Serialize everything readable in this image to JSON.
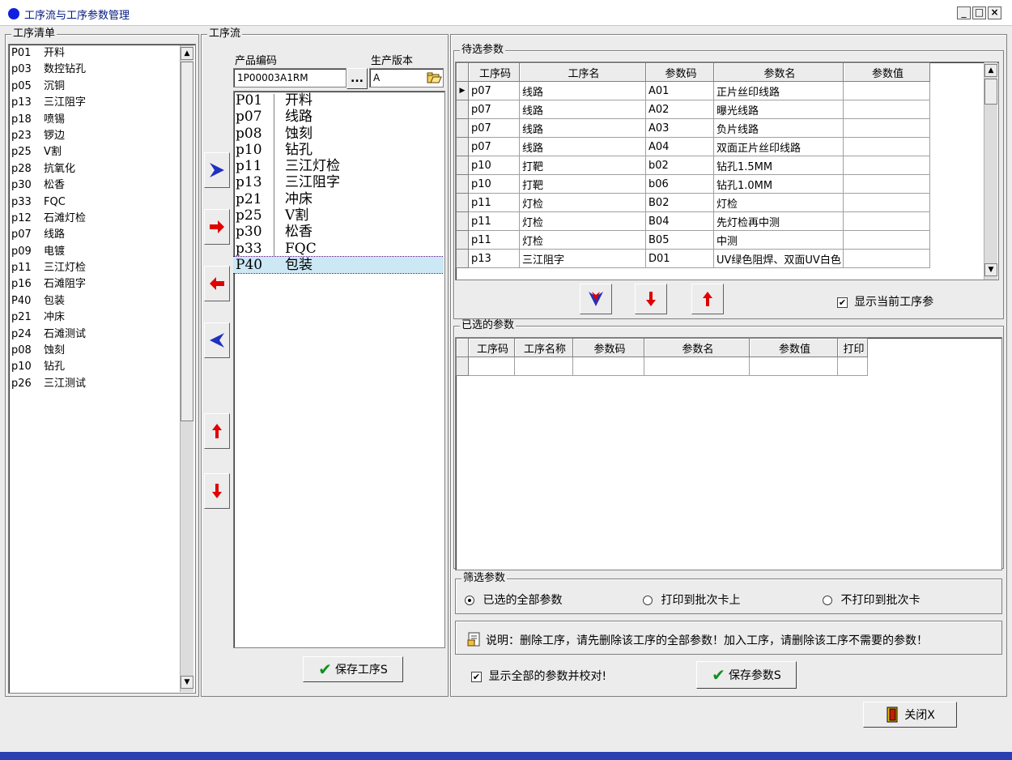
{
  "window": {
    "title": "工序流与工序参数管理",
    "minimize": "_",
    "maximize": "□",
    "close": "×"
  },
  "process_list": {
    "label": "工序清单",
    "items": [
      {
        "code": "P01",
        "name": "开料"
      },
      {
        "code": "p03",
        "name": "数控钻孔"
      },
      {
        "code": "p05",
        "name": "沉铜"
      },
      {
        "code": "p13",
        "name": "三江阻字"
      },
      {
        "code": "p18",
        "name": "喷锡"
      },
      {
        "code": "p23",
        "name": "锣边"
      },
      {
        "code": "p25",
        "name": "V割"
      },
      {
        "code": "p28",
        "name": "抗氧化"
      },
      {
        "code": "p30",
        "name": "松香"
      },
      {
        "code": "p33",
        "name": "FQC"
      },
      {
        "code": "p12",
        "name": "石滩灯检"
      },
      {
        "code": "p07",
        "name": "线路"
      },
      {
        "code": "p09",
        "name": "电镀"
      },
      {
        "code": "p11",
        "name": "三江灯检"
      },
      {
        "code": "p16",
        "name": "石滩阻字"
      },
      {
        "code": "P40",
        "name": "包装"
      },
      {
        "code": "p21",
        "name": "冲床"
      },
      {
        "code": "p24",
        "name": "石滩测试"
      },
      {
        "code": "p08",
        "name": "蚀刻"
      },
      {
        "code": "p10",
        "name": "钻孔"
      },
      {
        "code": "p26",
        "name": "三江测试"
      }
    ]
  },
  "flow": {
    "label": "工序流",
    "product_code_label": "产品编码",
    "product_code_value": "1P00003A1RM",
    "browse_button": "...",
    "version_label": "生产版本",
    "version_value": "A",
    "items": [
      {
        "code": "P01",
        "name": "开料"
      },
      {
        "code": "p07",
        "name": "线路"
      },
      {
        "code": "p08",
        "name": "蚀刻"
      },
      {
        "code": "p10",
        "name": "钻孔"
      },
      {
        "code": "p11",
        "name": "三江灯检"
      },
      {
        "code": "p13",
        "name": "三江阻字"
      },
      {
        "code": "p21",
        "name": "冲床"
      },
      {
        "code": "p25",
        "name": "V割"
      },
      {
        "code": "p30",
        "name": "松香"
      },
      {
        "code": "p33",
        "name": "FQC"
      },
      {
        "code": "P40",
        "name": "包装"
      }
    ],
    "save_button": "保存工序S"
  },
  "candidates": {
    "label": "待选参数",
    "columns": [
      "工序码",
      "工序名",
      "参数码",
      "参数名",
      "参数值"
    ],
    "rows": [
      [
        "p07",
        "线路",
        "A01",
        "正片丝印线路",
        ""
      ],
      [
        "p07",
        "线路",
        "A02",
        "曝光线路",
        ""
      ],
      [
        "p07",
        "线路",
        "A03",
        "负片线路",
        ""
      ],
      [
        "p07",
        "线路",
        "A04",
        "双面正片丝印线路",
        ""
      ],
      [
        "p10",
        "打靶",
        "b02",
        "钻孔1.5MM",
        ""
      ],
      [
        "p10",
        "打靶",
        "b06",
        "钻孔1.0MM",
        ""
      ],
      [
        "p11",
        "灯检",
        "B02",
        "灯检",
        ""
      ],
      [
        "p11",
        "灯检",
        "B04",
        "先灯检再中测",
        ""
      ],
      [
        "p11",
        "灯检",
        "B05",
        "中测",
        ""
      ],
      [
        "p13",
        "三江阻字",
        "D01",
        "UV绿色阻焊、双面UV白色",
        ""
      ]
    ],
    "show_current_label": "显示当前工序参"
  },
  "selected": {
    "label": "已选的参数",
    "columns": [
      "工序码",
      "工序名称",
      "参数码",
      "参数名",
      "参数值",
      "打印"
    ]
  },
  "filter": {
    "label": "筛选参数",
    "options": [
      "已选的全部参数",
      "打印到批次卡上",
      "不打印到批次卡"
    ]
  },
  "note": "说明：删除工序，请先删除该工序的全部参数！加入工序，请删除该工序不需要的参数！",
  "show_all_label": "显示全部的参数并校对!",
  "save_params_button": "保存参数S",
  "close_button": "关闭X"
}
